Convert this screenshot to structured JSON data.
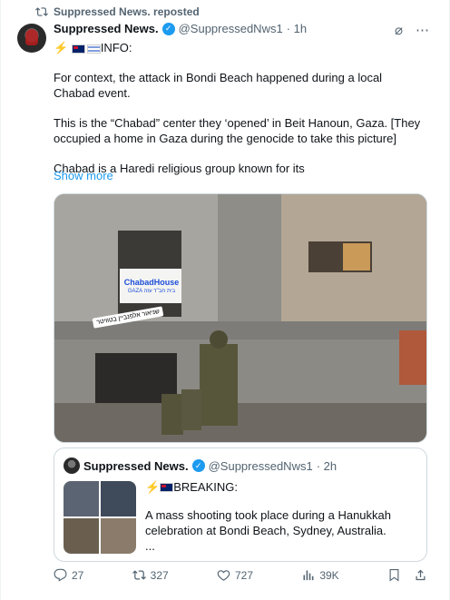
{
  "repost": {
    "text": "Suppressed News. reposted"
  },
  "author": {
    "name": "Suppressed News.",
    "handle": "@SuppressedNws1",
    "time": "· 1h"
  },
  "body": {
    "header": "INFO:",
    "paragraphs": [
      "For context, the attack in Bondi Beach happened during a local Chabad event.",
      "This is the “Chabad” center they ‘opened’ in Beit Hanoun, Gaza. [They occupied a home in Gaza during the genocide to take this picture]",
      "Chabad is a Haredi religious group known for its"
    ],
    "show_more": "Show more"
  },
  "photo": {
    "banner_line1": "ChabadHouse",
    "banner_line2": "GAZA בית חב\"ד עזה",
    "sticker": "שניאור אלפנביין בטוויטר"
  },
  "quote": {
    "name": "Suppressed News.",
    "handle": "@SuppressedNws1",
    "time": "· 2h",
    "header": "BREAKING:",
    "text": "A mass shooting took place during a Hanukkah celebration at Bondi Beach, Sydney, Australia.",
    "ellipsis": "..."
  },
  "actions": {
    "replies": "27",
    "reposts": "327",
    "likes": "727",
    "views": "39K"
  },
  "colors": {
    "accent": "#1d9bf0",
    "muted": "#536471"
  }
}
